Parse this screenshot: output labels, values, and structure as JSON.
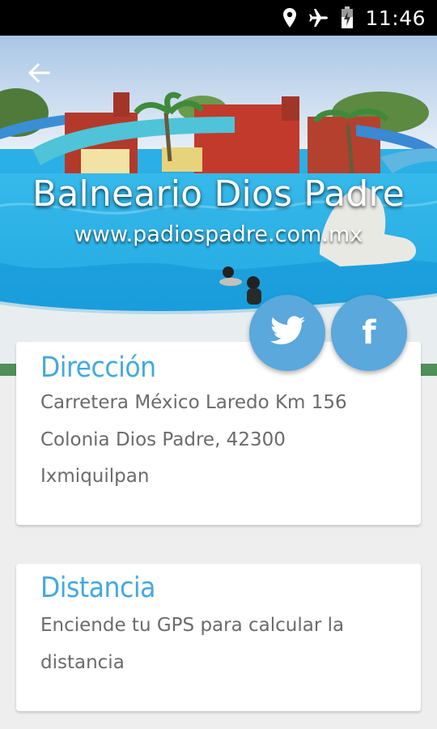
{
  "status_bar": {
    "time": "11:46",
    "icons": [
      "location-icon",
      "airplane-icon",
      "battery-icon"
    ]
  },
  "header": {
    "back_icon": "back-arrow-icon",
    "title": "Balneario Dios Padre",
    "website": "www.padiospadre.com.mx"
  },
  "social": {
    "twitter_icon": "twitter-icon",
    "facebook_icon": "facebook-icon",
    "facebook_glyph": "f",
    "button_color": "#5aa8dc"
  },
  "address_card": {
    "heading": "Dirección",
    "lines": [
      "Carretera México Laredo Km 156",
      "Colonia Dios Padre, 42300",
      "Ixmiquilpan"
    ]
  },
  "distance_card": {
    "heading": "Distancia",
    "lines": [
      "Enciende tu GPS para calcular la",
      "distancia"
    ]
  },
  "colors": {
    "accent": "#44a9de",
    "text_secondary": "#6b6b6b",
    "background": "#eeeeee"
  }
}
